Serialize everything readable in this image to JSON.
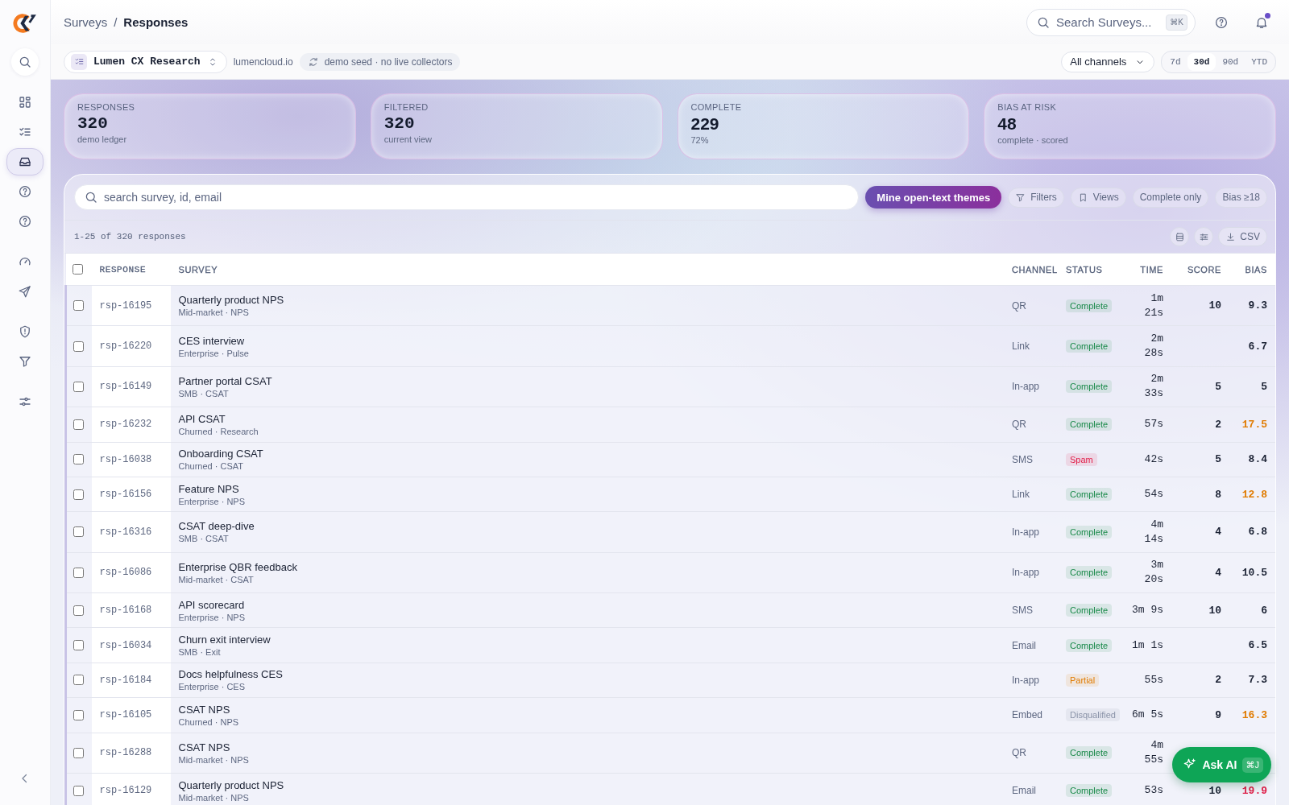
{
  "sidebar": {
    "items": [
      {
        "selected": false
      },
      {
        "selected": false
      },
      {
        "selected": false
      },
      {
        "selected": true
      },
      {
        "selected": false
      },
      {
        "selected": false
      },
      {
        "selected": false
      },
      {
        "selected": false
      },
      {
        "selected": false
      },
      {
        "selected": false
      },
      {
        "selected": false
      }
    ]
  },
  "breadcrumb": {
    "parent": "Surveys",
    "separator": "/",
    "current": "Responses"
  },
  "global_search": {
    "placeholder": "Search Surveys...",
    "shortcut": "⌘K"
  },
  "notifications": {
    "unread": true
  },
  "workspace": {
    "name": "Lumen CX Research",
    "domain": "lumencloud.io",
    "sync_note": "demo seed · no live collectors"
  },
  "channel_filter": {
    "value": "All channels"
  },
  "ranges": [
    {
      "label": "7d",
      "selected": false
    },
    {
      "label": "30d",
      "selected": true
    },
    {
      "label": "90d",
      "selected": false
    },
    {
      "label": "YTD",
      "selected": false
    }
  ],
  "kpis": [
    {
      "label": "RESPONSES",
      "value": "320",
      "note": "demo ledger"
    },
    {
      "label": "FILTERED",
      "value": "320",
      "note": "current view"
    },
    {
      "label": "COMPLETE",
      "value": "229",
      "note": "72%"
    },
    {
      "label": "BIAS AT RISK",
      "value": "48",
      "note": "complete · scored"
    }
  ],
  "toolbar": {
    "search_placeholder": "search survey, id, email",
    "primary": "Mine open-text themes",
    "chips": [
      "Filters",
      "Views",
      "Complete only",
      "Bias ≥18"
    ],
    "range_text": "1-25 of 320 responses",
    "export": "CSV"
  },
  "table": {
    "select_all": {
      "checked": false
    },
    "columns": [
      "RESPONSE",
      "SURVEY",
      "CHANNEL",
      "STATUS",
      "TIME",
      "SCORE",
      "BIAS"
    ],
    "rows": [
      {
        "checked": false,
        "id": "rsp-16195",
        "survey": "Quarterly product NPS",
        "segment": "Mid-market · NPS",
        "channel": "QR",
        "status": {
          "text": "Complete",
          "color": "#1a8a4a"
        },
        "time": "1m 21s",
        "score": "10",
        "bias": {
          "text": "9.3",
          "color": "#1a2133"
        }
      },
      {
        "checked": false,
        "id": "rsp-16220",
        "survey": "CES interview",
        "segment": "Enterprise · Pulse",
        "channel": "Link",
        "status": {
          "text": "Complete",
          "color": "#1a8a4a"
        },
        "time": "2m 28s",
        "bias": {
          "text": "6.7",
          "color": "#1a2133"
        }
      },
      {
        "checked": false,
        "id": "rsp-16149",
        "survey": "Partner portal CSAT",
        "segment": "SMB · CSAT",
        "channel": "In-app",
        "status": {
          "text": "Complete",
          "color": "#1a8a4a"
        },
        "time": "2m 33s",
        "score": "5",
        "bias": {
          "text": "5",
          "color": "#1a2133"
        }
      },
      {
        "checked": false,
        "id": "rsp-16232",
        "survey": "API CSAT",
        "segment": "Churned · Research",
        "channel": "QR",
        "status": {
          "text": "Complete",
          "color": "#1a8a4a"
        },
        "time": "57s",
        "score": "2",
        "bias": {
          "text": "17.5",
          "color": "#e07b00"
        }
      },
      {
        "checked": false,
        "id": "rsp-16038",
        "survey": "Onboarding CSAT",
        "segment": "Churned · CSAT",
        "channel": "SMS",
        "status": {
          "text": "Spam",
          "color": "#e11d48"
        },
        "time": "42s",
        "score": "5",
        "bias": {
          "text": "8.4",
          "color": "#1a2133"
        }
      },
      {
        "checked": false,
        "id": "rsp-16156",
        "survey": "Feature NPS",
        "segment": "Enterprise · NPS",
        "channel": "Link",
        "status": {
          "text": "Complete",
          "color": "#1a8a4a"
        },
        "time": "54s",
        "score": "8",
        "bias": {
          "text": "12.8",
          "color": "#e07b00"
        }
      },
      {
        "checked": false,
        "id": "rsp-16316",
        "survey": "CSAT deep-dive",
        "segment": "SMB · CSAT",
        "channel": "In-app",
        "status": {
          "text": "Complete",
          "color": "#1a8a4a"
        },
        "time": "4m 14s",
        "score": "4",
        "bias": {
          "text": "6.8",
          "color": "#1a2133"
        }
      },
      {
        "checked": false,
        "id": "rsp-16086",
        "survey": "Enterprise QBR feedback",
        "segment": "Mid-market · CSAT",
        "channel": "In-app",
        "status": {
          "text": "Complete",
          "color": "#1a8a4a"
        },
        "time": "3m 20s",
        "score": "4",
        "bias": {
          "text": "10.5",
          "color": "#1a2133"
        }
      },
      {
        "checked": false,
        "id": "rsp-16168",
        "survey": "API scorecard",
        "segment": "Enterprise · NPS",
        "channel": "SMS",
        "status": {
          "text": "Complete",
          "color": "#1a8a4a"
        },
        "time": "3m 9s",
        "score": "10",
        "bias": {
          "text": "6",
          "color": "#1a2133"
        }
      },
      {
        "checked": false,
        "id": "rsp-16034",
        "survey": "Churn exit interview",
        "segment": "SMB · Exit",
        "channel": "Email",
        "status": {
          "text": "Complete",
          "color": "#1a8a4a"
        },
        "time": "1m 1s",
        "bias": {
          "text": "6.5",
          "color": "#1a2133"
        }
      },
      {
        "checked": false,
        "id": "rsp-16184",
        "survey": "Docs helpfulness CES",
        "segment": "Enterprise · CES",
        "channel": "In-app",
        "status": {
          "text": "Partial",
          "color": "#e07b00"
        },
        "time": "55s",
        "score": "2",
        "bias": {
          "text": "7.3",
          "color": "#1a2133"
        }
      },
      {
        "checked": false,
        "id": "rsp-16105",
        "survey": "CSAT NPS",
        "segment": "Churned · NPS",
        "channel": "Embed",
        "status": {
          "text": "Disqualified",
          "color": "#8a93a8"
        },
        "time": "6m 5s",
        "score": "9",
        "bias": {
          "text": "16.3",
          "color": "#e07b00"
        }
      },
      {
        "checked": false,
        "id": "rsp-16288",
        "survey": "CSAT NPS",
        "segment": "Mid-market · NPS",
        "channel": "QR",
        "status": {
          "text": "Complete",
          "color": "#1a8a4a"
        },
        "time": "4m 55s"
      },
      {
        "checked": false,
        "id": "rsp-16129",
        "survey": "Quarterly product NPS",
        "segment": "Mid-market · NPS",
        "channel": "Email",
        "status": {
          "text": "Complete",
          "color": "#1a8a4a"
        },
        "time": "53s",
        "score": "10",
        "bias": {
          "text": "19.9",
          "color": "#e11d48"
        }
      }
    ]
  },
  "assistant": {
    "label": "Ask AI",
    "shortcut": "⌘J"
  }
}
